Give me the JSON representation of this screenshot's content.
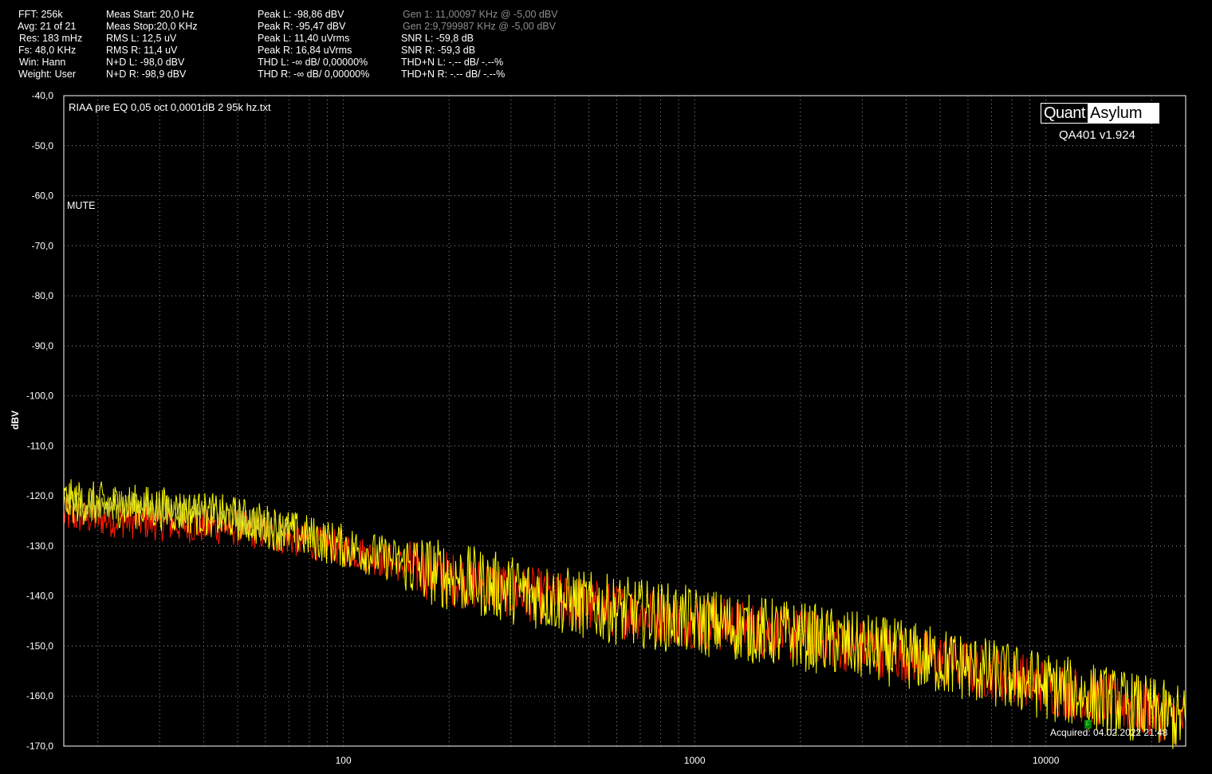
{
  "stats": {
    "col1": [
      "FFT: 256k",
      "Avg: 21 of 21",
      "Res: 183 mHz",
      "Fs: 48,0 KHz",
      "Win: Hann",
      "Weight: User"
    ],
    "col2": [
      "Meas Start: 20,0 Hz",
      "Meas Stop:20,0 KHz",
      "RMS L: 12,5 uV",
      "RMS R: 11,4 uV",
      "N+D L: -98,0 dBV",
      "N+D R: -98,9 dBV"
    ],
    "col3": [
      "Peak L: -98,86 dBV",
      "Peak R: -95,47 dBV",
      "Peak L: 11,40 uVrms",
      "Peak R: 16,84 uVrms",
      "THD L: -∞ dB/ 0,00000%",
      "THD R: -∞ dB/ 0,00000%"
    ],
    "col4": [
      "Gen 1: 11,00097 KHz @ -5,00  dBV",
      "Gen 2:9,799987 KHz @ -5,00  dBV",
      "SNR L: -59,8 dB",
      "SNR R: -59,3 dB",
      "THD+N L: -.-- dB/ -.--%",
      "THD+N R: -.-- dB/ -.--%"
    ]
  },
  "logo": {
    "left": "Quant",
    "right": "Asylum"
  },
  "version": "QA401 v1.924",
  "filename": "RIAA pre EQ 0,05 oct 0,0001dB 2 95k hz.txt",
  "mute_label": "MUTE",
  "acquired": "Acquired: 04.02.2022  21:48",
  "marker_label": "F",
  "colors": {
    "left": "#ffff00",
    "right": "#ff1a00",
    "left_low": "#c8c830",
    "grid": "#9a9a9a",
    "frame": "#ffffff"
  },
  "chart_data": {
    "type": "line",
    "title": "",
    "xlabel": "",
    "ylabel": "dBV",
    "x_scale": "log",
    "xlim": [
      16,
      25000
    ],
    "ylim": [
      -170,
      -40
    ],
    "y_ticks": [
      "-40,0",
      "-50,0",
      "-60,0",
      "-70,0",
      "-80,0",
      "-90,0",
      "-100,0",
      "-110,0",
      "-120,0",
      "-130,0",
      "-140,0",
      "-150,0",
      "-160,0",
      "-170,0"
    ],
    "y_tick_values": [
      -40,
      -50,
      -60,
      -70,
      -80,
      -90,
      -100,
      -110,
      -120,
      -130,
      -140,
      -150,
      -160,
      -170
    ],
    "x_ticks": [
      "100",
      "1000",
      "10000"
    ],
    "x_tick_values": [
      100,
      1000,
      10000
    ],
    "grid": true,
    "series": [
      {
        "key": "left",
        "trend": [
          [
            16,
            -121
          ],
          [
            30,
            -122.5
          ],
          [
            50,
            -124.5
          ],
          [
            100,
            -130
          ],
          [
            200,
            -136
          ],
          [
            500,
            -142
          ],
          [
            1000,
            -145
          ],
          [
            2000,
            -148
          ],
          [
            5000,
            -153
          ],
          [
            10000,
            -158
          ],
          [
            20000,
            -163
          ],
          [
            25000,
            -165
          ]
        ],
        "noise": 5
      },
      {
        "key": "right",
        "trend": [
          [
            16,
            -124
          ],
          [
            30,
            -125.5
          ],
          [
            50,
            -126.5
          ],
          [
            100,
            -130.5
          ],
          [
            200,
            -136.5
          ],
          [
            500,
            -142
          ],
          [
            1000,
            -145
          ],
          [
            2000,
            -148
          ],
          [
            5000,
            -153
          ],
          [
            10000,
            -158
          ],
          [
            20000,
            -163
          ],
          [
            25000,
            -165
          ]
        ],
        "noise": 4
      }
    ]
  }
}
